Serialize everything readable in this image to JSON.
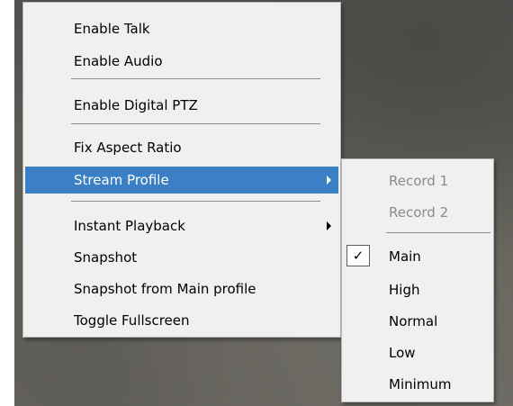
{
  "main_menu": {
    "items": [
      {
        "label": "Enable Talk"
      },
      {
        "label": "Enable Audio"
      },
      {
        "label": "Enable Digital PTZ"
      },
      {
        "label": "Fix Aspect Ratio"
      },
      {
        "label": "Stream Profile",
        "highlighted": true,
        "has_submenu": true
      },
      {
        "label": "Instant Playback",
        "has_submenu": true
      },
      {
        "label": "Snapshot"
      },
      {
        "label": "Snapshot from Main profile"
      },
      {
        "label": "Toggle Fullscreen"
      }
    ]
  },
  "stream_profile_menu": {
    "items": [
      {
        "label": "Record 1",
        "enabled": false
      },
      {
        "label": "Record 2",
        "enabled": false
      },
      {
        "label": "Main",
        "checked": true
      },
      {
        "label": "High"
      },
      {
        "label": "Normal"
      },
      {
        "label": "Low"
      },
      {
        "label": "Minimum"
      }
    ],
    "check_glyph": "✓"
  },
  "colors": {
    "highlight": "#3b7fc4",
    "menu_background": "#f0f0f0",
    "disabled_text": "#8a8a8a"
  }
}
